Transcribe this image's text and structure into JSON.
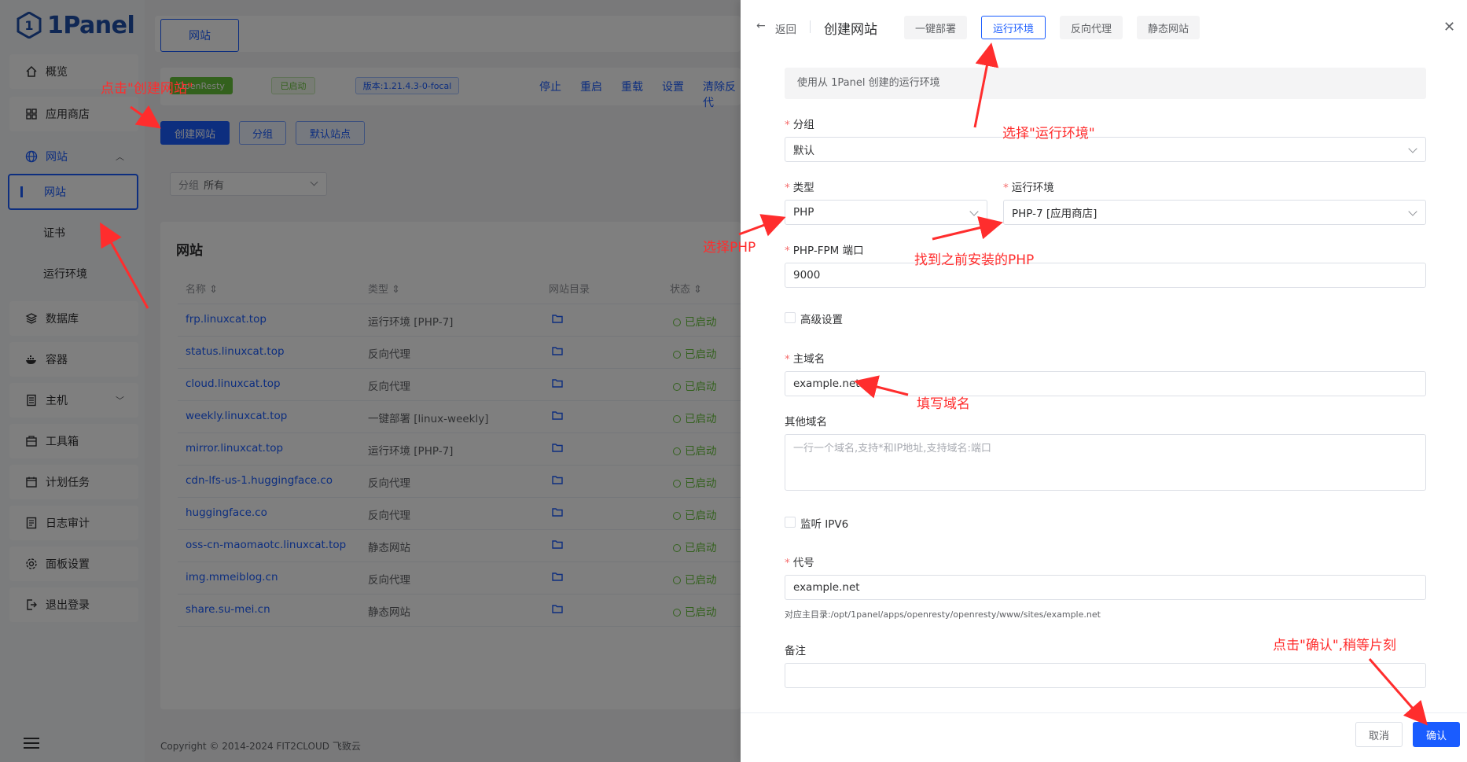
{
  "app": {
    "logo_text": "1Panel",
    "sidebar": {
      "items": [
        {
          "label": "概览",
          "icon": "home-icon"
        },
        {
          "label": "应用商店",
          "icon": "grid-icon"
        },
        {
          "label": "网站",
          "icon": "globe-icon"
        },
        {
          "label": "网站",
          "icon": ""
        },
        {
          "label": "证书",
          "icon": ""
        },
        {
          "label": "运行环境",
          "icon": ""
        },
        {
          "label": "数据库",
          "icon": "layers-icon"
        },
        {
          "label": "容器",
          "icon": "docker-icon"
        },
        {
          "label": "主机",
          "icon": "server-icon"
        },
        {
          "label": "工具箱",
          "icon": "toolbox-icon"
        },
        {
          "label": "计划任务",
          "icon": "calendar-icon"
        },
        {
          "label": "日志审计",
          "icon": "log-icon"
        },
        {
          "label": "面板设置",
          "icon": "gear-icon"
        },
        {
          "label": "退出登录",
          "icon": "logout-icon"
        }
      ]
    },
    "header_tab": "网站",
    "status_bar": {
      "app_tag": "OpenResty",
      "status": "已启动",
      "version": "版本:1.21.4.3-0-focal",
      "actions": [
        "停止",
        "重启",
        "重载",
        "设置",
        "清除反代"
      ]
    },
    "toolbar": {
      "create": "创建网站",
      "group": "分组",
      "default_site": "默认站点"
    },
    "filter": {
      "label": "分组",
      "value": "所有"
    },
    "table": {
      "title": "网站",
      "columns": [
        "名称",
        "类型",
        "网站目录",
        "状态"
      ],
      "rows": [
        {
          "name": "frp.linuxcat.top",
          "type": "运行环境 [PHP-7]",
          "status": "已启动"
        },
        {
          "name": "status.linuxcat.top",
          "type": "反向代理",
          "status": "已启动"
        },
        {
          "name": "cloud.linuxcat.top",
          "type": "反向代理",
          "status": "已启动"
        },
        {
          "name": "weekly.linuxcat.top",
          "type": "一键部署 [linux-weekly]",
          "status": "已启动"
        },
        {
          "name": "mirror.linuxcat.top",
          "type": "运行环境 [PHP-7]",
          "status": "已启动"
        },
        {
          "name": "cdn-lfs-us-1.huggingface.co",
          "type": "反向代理",
          "status": "已启动"
        },
        {
          "name": "huggingface.co",
          "type": "反向代理",
          "status": "已启动"
        },
        {
          "name": "oss-cn-maomaotc.linuxcat.top",
          "type": "静态网站",
          "status": "已启动"
        },
        {
          "name": "img.mmeiblog.cn",
          "type": "反向代理",
          "status": "已启动"
        },
        {
          "name": "share.su-mei.cn",
          "type": "静态网站",
          "status": "已启动"
        }
      ]
    },
    "copyright": "Copyright © 2014-2024 FIT2CLOUD 飞致云"
  },
  "drawer": {
    "back": "返回",
    "title": "创建网站",
    "tabs": [
      "一键部署",
      "运行环境",
      "反向代理",
      "静态网站"
    ],
    "active_tab_index": 1,
    "info": "使用从 1Panel 创建的运行环境",
    "group": {
      "label": "分组",
      "value": "默认"
    },
    "type": {
      "label": "类型",
      "value": "PHP"
    },
    "runtime": {
      "label": "运行环境",
      "value": "PHP-7 [应用商店]"
    },
    "fpm_port": {
      "label": "PHP-FPM 端口",
      "value": "9000"
    },
    "advanced": "高级设置",
    "primary_domain": {
      "label": "主域名",
      "value": "example.net"
    },
    "other_domains": {
      "label": "其他域名",
      "placeholder": "一行一个域名,支持*和IP地址,支持域名:端口"
    },
    "ipv6": "监听 IPV6",
    "alias": {
      "label": "代号",
      "value": "example.net"
    },
    "site_dir_hint": "对应主目录:/opt/1panel/apps/openresty/openresty/www/sites/example.net",
    "remark": {
      "label": "备注",
      "value": ""
    },
    "cancel": "取消",
    "confirm": "确认"
  },
  "annotations": {
    "click_create": "点击\"创建网站\"",
    "select_runtime": "选择\"运行环境\"",
    "select_php": "选择PHP",
    "find_php": "找到之前安装的PHP",
    "fill_domain": "填写域名",
    "click_confirm": "点击\"确认\",稍等片刻"
  },
  "colors": {
    "primary": "#1a5cff",
    "success": "#67c23a",
    "annotation": "#ff2d2d"
  }
}
